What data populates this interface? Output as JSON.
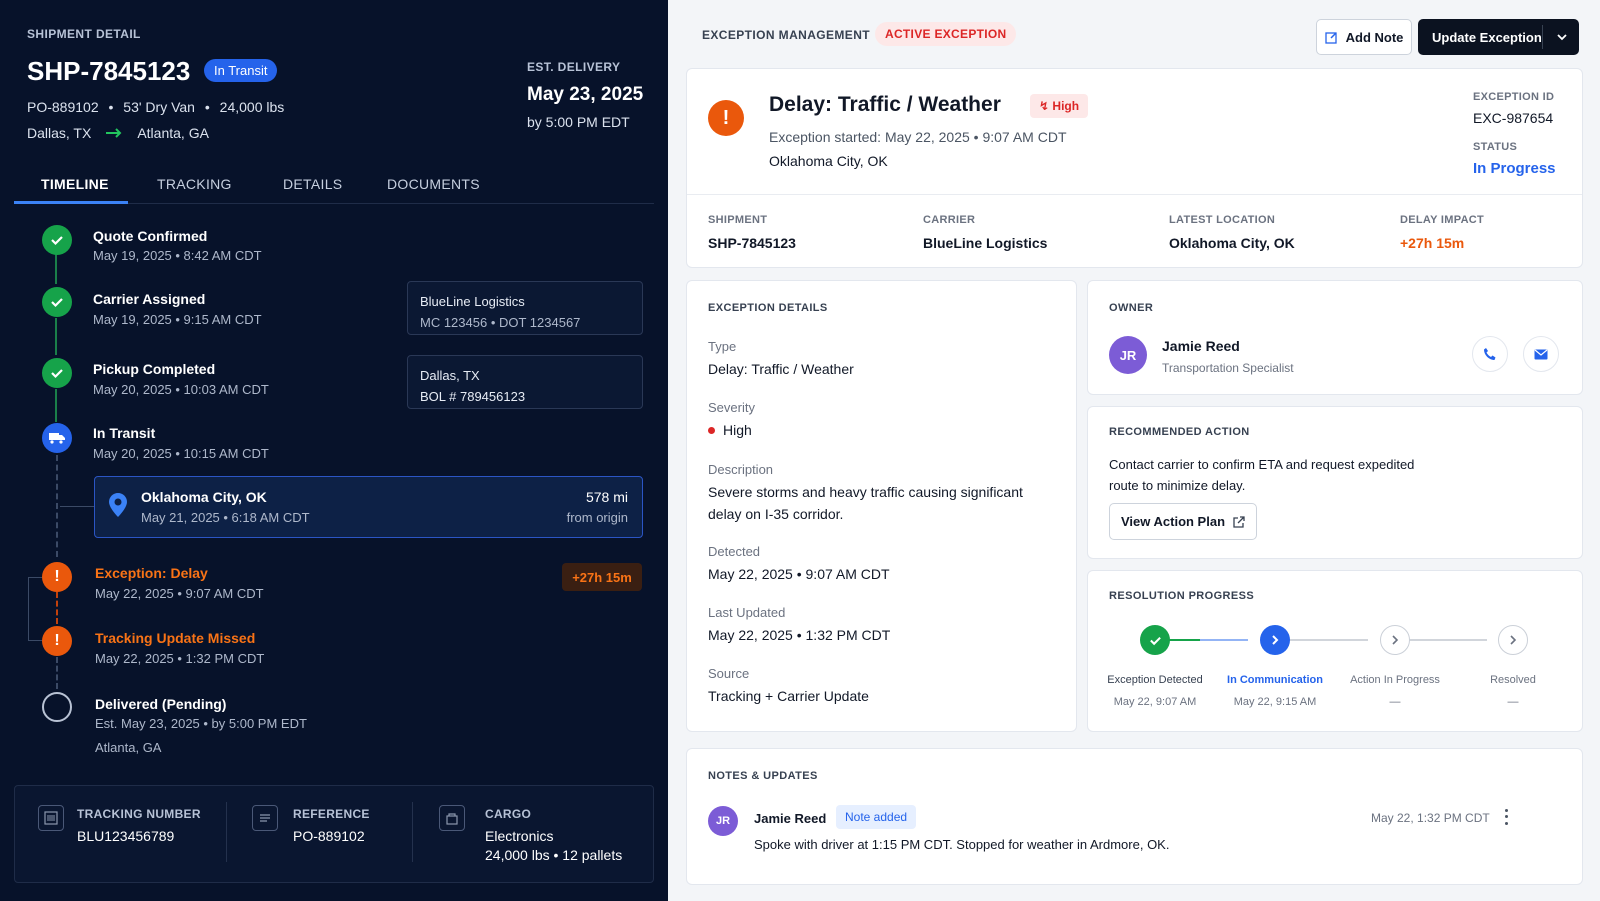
{
  "shipment": {
    "section_label": "SHIPMENT DETAIL",
    "id": "SHP-7845123",
    "status": "In Transit",
    "po": "PO-889102",
    "equipment": "53' Dry Van",
    "weight": "24,000 lbs",
    "origin": "Dallas, TX",
    "destination": "Atlanta, GA",
    "est_label": "EST. DELIVERY",
    "est_date": "May 23, 2025",
    "est_time": "by 5:00 PM EDT"
  },
  "tabs": [
    "TIMELINE",
    "TRACKING",
    "DETAILS",
    "DOCUMENTS"
  ],
  "timeline": {
    "quote": {
      "title": "Quote Confirmed",
      "time": "May 19, 2025  •  8:42 AM CDT"
    },
    "carrier": {
      "title": "Carrier Assigned",
      "time": "May 19, 2025  •  9:15 AM CDT",
      "box_line1": "BlueLine Logistics",
      "box_line2": "MC 123456  •  DOT 1234567"
    },
    "pickup": {
      "title": "Pickup Completed",
      "time": "May 20, 2025  •  10:03 AM CDT",
      "box_line1": "Dallas, TX",
      "box_line2": "BOL # 789456123"
    },
    "transit": {
      "title": "In Transit",
      "time": "May 20, 2025  •  10:15 AM CDT"
    },
    "location": {
      "city": "Oklahoma City, OK",
      "time": "May 21, 2025  •  6:18 AM CDT",
      "distance": "578 mi",
      "distance_sub": "from origin"
    },
    "exception": {
      "title": "Exception: Delay",
      "time": "May 22, 2025  •  9:07 AM CDT",
      "badge": "+27h 15m"
    },
    "missed": {
      "title": "Tracking Update Missed",
      "time": "May 22, 2025  •  1:32 PM CDT"
    },
    "delivered": {
      "title": "Delivered (Pending)",
      "time": "Est. May 23, 2025  •  by 5:00 PM EDT",
      "place": "Atlanta, GA"
    }
  },
  "summary": {
    "tracking_label": "TRACKING NUMBER",
    "tracking_value": "BLU123456789",
    "reference_label": "REFERENCE",
    "reference_value": "PO-889102",
    "cargo_label": "CARGO",
    "cargo_value": "Electronics",
    "cargo_detail": "24,000 lbs  •  12 pallets"
  },
  "header": {
    "title": "EXCEPTION MANAGEMENT",
    "badge": "ACTIVE EXCEPTION",
    "add_note": "Add Note",
    "update": "Update Exception"
  },
  "exception": {
    "title": "Delay: Traffic / Weather",
    "severity_badge": "High",
    "started": "Exception started: May 22, 2025  •  9:07 AM CDT",
    "location": "Oklahoma City, OK",
    "id_label": "EXCEPTION ID",
    "id": "EXC-987654",
    "status_label": "STATUS",
    "status": "In Progress"
  },
  "stats": {
    "shipment_label": "SHIPMENT",
    "shipment": "SHP-7845123",
    "carrier_label": "CARRIER",
    "carrier": "BlueLine Logistics",
    "loc_label": "LATEST LOCATION",
    "loc": "Oklahoma City, OK",
    "impact_label": "DELAY IMPACT",
    "impact": "+27h 15m"
  },
  "details": {
    "section": "EXCEPTION DETAILS",
    "type_label": "Type",
    "type": "Delay: Traffic / Weather",
    "severity_label": "Severity",
    "severity": "High",
    "desc_label": "Description",
    "desc": "Severe storms and heavy traffic causing significant delay on I-35 corridor.",
    "detected_label": "Detected",
    "detected": "May 22, 2025  •  9:07 AM CDT",
    "updated_label": "Last Updated",
    "updated": "May 22, 2025  •  1:32 PM CDT",
    "source_label": "Source",
    "source": "Tracking + Carrier Update"
  },
  "owner": {
    "section": "OWNER",
    "initials": "JR",
    "name": "Jamie Reed",
    "role": "Transportation Specialist"
  },
  "recommended": {
    "section": "RECOMMENDED ACTION",
    "text": "Contact carrier to confirm ETA and request expedited route to minimize delay.",
    "button": "View Action Plan"
  },
  "progress": {
    "section": "RESOLUTION PROGRESS",
    "steps": [
      {
        "label": "Exception Detected",
        "sub": "May 22, 9:07 AM"
      },
      {
        "label": "In Communication",
        "sub": "May 22, 9:15 AM"
      },
      {
        "label": "Action In Progress",
        "sub": "—"
      },
      {
        "label": "Resolved",
        "sub": "—"
      }
    ]
  },
  "notes": {
    "section": "NOTES & UPDATES",
    "initials": "JR",
    "author": "Jamie Reed",
    "tag": "Note added",
    "time": "May 22, 1:32 PM CDT",
    "text": "Spoke with driver at 1:15 PM CDT. Stopped for weather in Ardmore, OK."
  },
  "colors": {
    "accent": "#2563eb",
    "danger": "#dc2626",
    "warning": "#ea580c",
    "success": "#16a34a",
    "dark_bg": "#07122a"
  }
}
